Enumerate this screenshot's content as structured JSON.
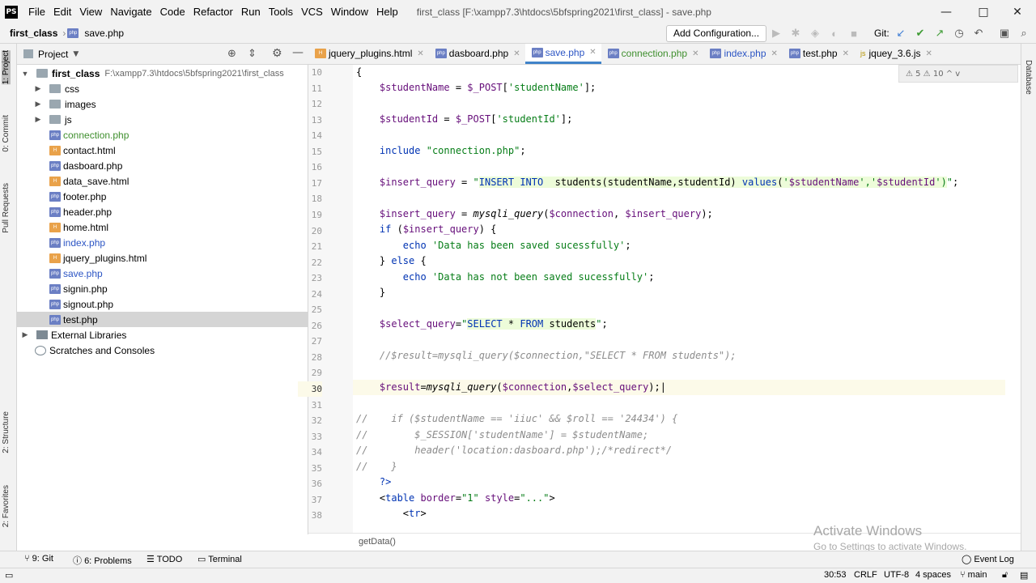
{
  "app": {
    "logo": "PS",
    "window_title": "first_class [F:\\xampp7.3\\htdocs\\5bfspring2021\\first_class] - save.php"
  },
  "menu": [
    "File",
    "Edit",
    "View",
    "Navigate",
    "Code",
    "Refactor",
    "Run",
    "Tools",
    "VCS",
    "Window",
    "Help"
  ],
  "window_controls": {
    "minimize": "—",
    "maximize": "□",
    "close": "✕"
  },
  "navbar": {
    "project": "first_class",
    "file": "save.php",
    "add_config": "Add Configuration...",
    "git_label": "Git:"
  },
  "project_panel": {
    "title": "Project",
    "root": {
      "name": "first_class",
      "path": "F:\\xampp7.3\\htdocs\\5bfspring2021\\first_class"
    },
    "folders": [
      "css",
      "images",
      "js"
    ],
    "files": [
      {
        "name": "connection.php",
        "type": "php",
        "vcs": "added"
      },
      {
        "name": "contact.html",
        "type": "html"
      },
      {
        "name": "dasboard.php",
        "type": "php"
      },
      {
        "name": "data_save.html",
        "type": "html"
      },
      {
        "name": "footer.php",
        "type": "php"
      },
      {
        "name": "header.php",
        "type": "php"
      },
      {
        "name": "home.html",
        "type": "html"
      },
      {
        "name": "index.php",
        "type": "php",
        "vcs": "modified"
      },
      {
        "name": "jquery_plugins.html",
        "type": "html"
      },
      {
        "name": "save.php",
        "type": "php",
        "vcs": "modified"
      },
      {
        "name": "signin.php",
        "type": "php"
      },
      {
        "name": "signout.php",
        "type": "php"
      },
      {
        "name": "test.php",
        "type": "php",
        "selected": true
      }
    ],
    "extra": [
      "External Libraries",
      "Scratches and Consoles"
    ]
  },
  "side_tabs": {
    "left_top": [
      "1: Project",
      "0: Commit",
      "Pull Requests"
    ],
    "left_bottom": [
      "2: Structure",
      "2: Favorites"
    ],
    "right": [
      "Database"
    ]
  },
  "tabs": [
    {
      "label": "jquery_plugins.html",
      "type": "html"
    },
    {
      "label": "dasboard.php",
      "type": "php"
    },
    {
      "label": "save.php",
      "type": "php",
      "active": true
    },
    {
      "label": "connection.php",
      "type": "php"
    },
    {
      "label": "index.php",
      "type": "php"
    },
    {
      "label": "test.php",
      "type": "php"
    },
    {
      "label": "jquey_3.6.js",
      "type": "js"
    }
  ],
  "inspection_widget": "⚠ 5  ⚠ 10  ^  v",
  "code": {
    "line_numbers": [
      10,
      11,
      12,
      13,
      14,
      15,
      16,
      17,
      18,
      19,
      20,
      21,
      22,
      23,
      24,
      25,
      26,
      27,
      28,
      29,
      30,
      31,
      32,
      33,
      34,
      35,
      36,
      37,
      38
    ],
    "caret_line": 30
  },
  "footer_crumb": "getData()",
  "bottom_tools": [
    "9: Git",
    "6: Problems",
    "TODO",
    "Terminal",
    "Event Log"
  ],
  "status": {
    "position": "30:53",
    "line_sep": "CRLF",
    "encoding": "UTF-8",
    "indent": "4 spaces",
    "branch": "main"
  },
  "watermark": {
    "line1": "Activate Windows",
    "line2": "Go to Settings to activate Windows."
  }
}
